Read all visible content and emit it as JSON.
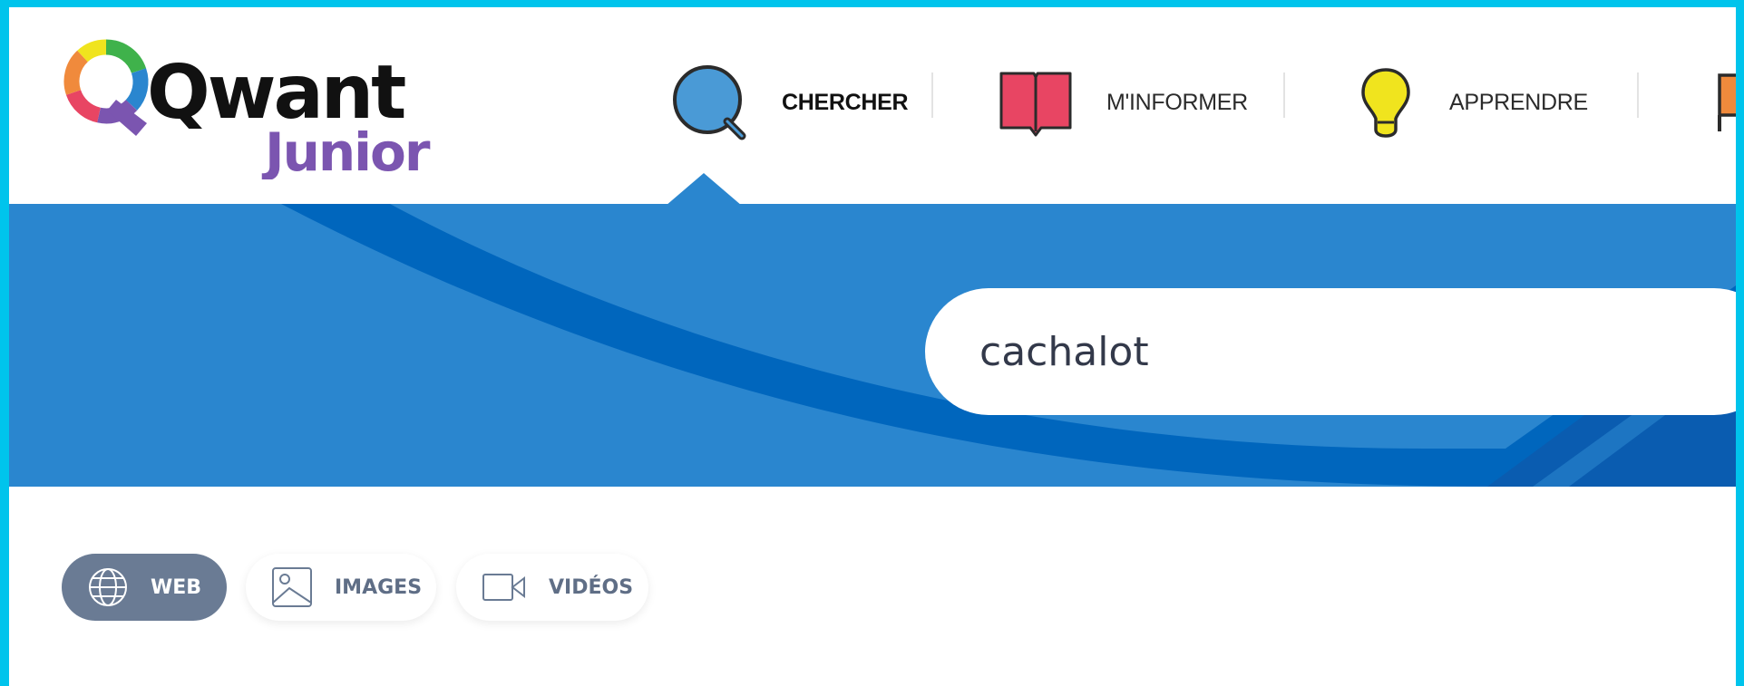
{
  "brand": {
    "logo_wordmark": "Qwant",
    "logo_sub": "Junior"
  },
  "nav": {
    "items": [
      {
        "label": "CHERCHER",
        "icon": "magnifier-icon",
        "color": "#4a9ad6",
        "active": true
      },
      {
        "label": "M'INFORMER",
        "icon": "book-icon",
        "color": "#e84563",
        "active": false
      },
      {
        "label": "APPRENDRE",
        "icon": "lightbulb-icon",
        "color": "#f0e41e",
        "active": false
      }
    ],
    "overflow_icon_color": "#f08a3c"
  },
  "search": {
    "value": "cachalot"
  },
  "filters": [
    {
      "label": "WEB",
      "icon": "globe-icon",
      "active": true
    },
    {
      "label": "IMAGES",
      "icon": "image-icon",
      "active": false
    },
    {
      "label": "VIDÉOS",
      "icon": "video-icon",
      "active": false
    }
  ],
  "colors": {
    "frame": "#00c4ec",
    "hero_blue": "#2a86cf",
    "hero_dark": "#0066bd",
    "active_tab": "#6a7b94",
    "logo_purple": "#7b55b0"
  }
}
